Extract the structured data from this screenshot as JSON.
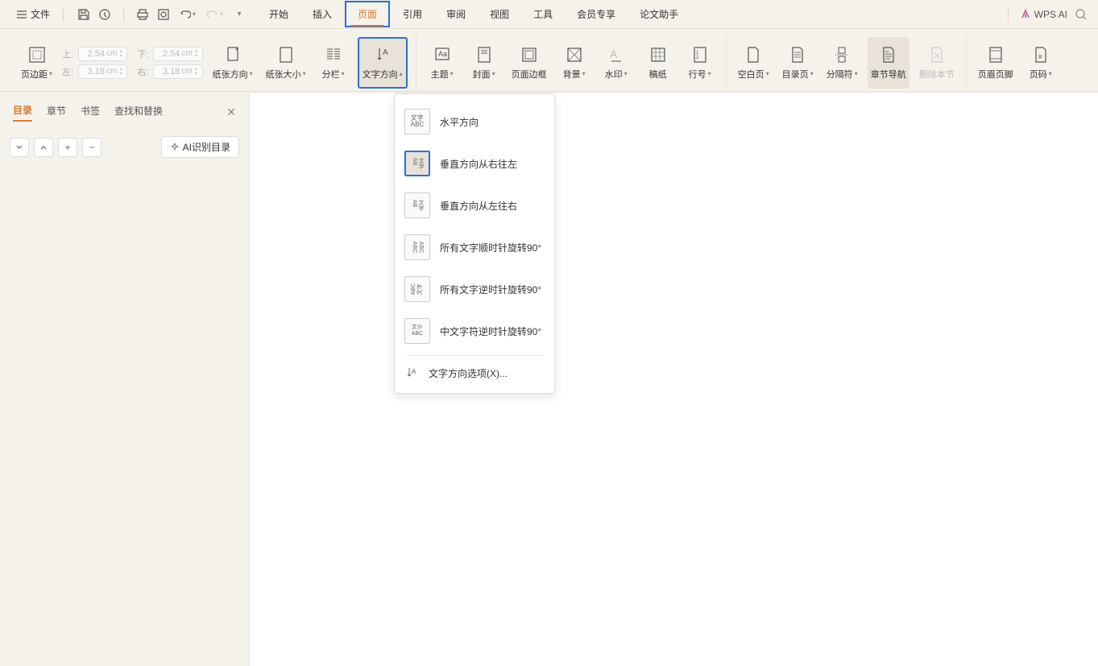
{
  "topbar": {
    "file_label": "文件",
    "tabs": [
      "开始",
      "插入",
      "页面",
      "引用",
      "审阅",
      "视图",
      "工具",
      "会员专享",
      "论文助手"
    ],
    "active_tab_index": 2,
    "wps_ai_label": "WPS AI"
  },
  "ribbon": {
    "page_margin": "页边距",
    "margins": {
      "top_label": "上:",
      "top_val": "2.54",
      "bottom_label": "下:",
      "bottom_val": "2.54",
      "left_label": "左:",
      "left_val": "3.18",
      "right_label": "右:",
      "right_val": "3.18",
      "unit": "cm"
    },
    "paper_orientation": "纸张方向",
    "paper_size": "纸张大小",
    "columns": "分栏",
    "text_direction": "文字方向",
    "theme": "主题",
    "cover": "封面",
    "page_border": "页面边框",
    "background": "背景",
    "watermark": "水印",
    "manuscript": "稿纸",
    "line_number": "行号",
    "blank_page": "空白页",
    "toc_page": "目录页",
    "separator": "分隔符",
    "chapter_nav": "章节导航",
    "delete_section": "删除本节",
    "header_footer": "页眉页脚",
    "page_number": "页码"
  },
  "sidebar": {
    "tabs": [
      "目录",
      "章节",
      "书签",
      "查找和替换"
    ],
    "active_tab_index": 0,
    "ai_toc_label": "AI识别目录"
  },
  "dropdown": {
    "items": [
      "水平方向",
      "垂直方向从右往左",
      "垂直方向从左往右",
      "所有文字顺时针旋转90°",
      "所有文字逆时针旋转90°",
      "中文字符逆时针旋转90°"
    ],
    "selected_index": 1,
    "options_label": "文字方向选项(X)..."
  }
}
